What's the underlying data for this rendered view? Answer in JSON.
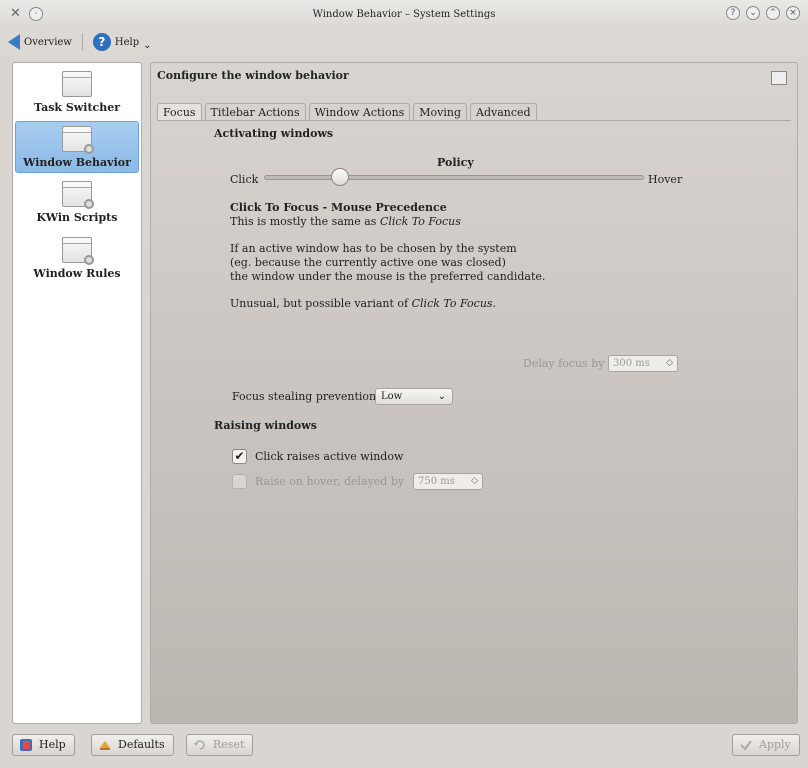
{
  "window": {
    "title": "Window Behavior – System Settings",
    "controls": [
      "?",
      "⌄",
      "⌃",
      "×"
    ]
  },
  "toolbar": {
    "overview_label": "Overview",
    "help_label": "Help"
  },
  "sidebar": {
    "items": [
      {
        "label": "Task Switcher"
      },
      {
        "label": "Window Behavior"
      },
      {
        "label": "KWin Scripts"
      },
      {
        "label": "Window Rules"
      }
    ]
  },
  "main": {
    "header": "Configure the window behavior",
    "tabs": [
      {
        "label": "Focus"
      },
      {
        "label": "Titlebar Actions"
      },
      {
        "label": "Window Actions"
      },
      {
        "label": "Moving"
      },
      {
        "label": "Advanced"
      }
    ]
  },
  "focus": {
    "activating_title": "Activating windows",
    "policy_label": "Policy",
    "slider_left": "Click",
    "slider_right": "Hover",
    "policy_position": 0.2,
    "policy_name": "Click To Focus - Mouse Precedence",
    "desc_line1_prefix": "This is mostly the same as ",
    "desc_line1_em": "Click To Focus",
    "desc_p2_l1": "If an active window has to be chosen by the system",
    "desc_p2_l2": "(eg. because the currently active one was closed)",
    "desc_p2_l3": "the window under the mouse is the preferred candidate.",
    "desc_p3_prefix": "Unusual, but possible variant of ",
    "desc_p3_em": "Click To Focus.",
    "delay_label": "Delay focus by",
    "delay_value": "300 ms",
    "stealing_label": "Focus stealing prevention",
    "stealing_value": "Low",
    "raising_title": "Raising windows",
    "click_raises_label": "Click raises active window",
    "click_raises_checked": "✔",
    "raise_hover_label": "Raise on hover, delayed by",
    "raise_hover_value": "750 ms"
  },
  "footer": {
    "help": "Help",
    "defaults": "Defaults",
    "reset": "Reset",
    "apply": "Apply"
  }
}
